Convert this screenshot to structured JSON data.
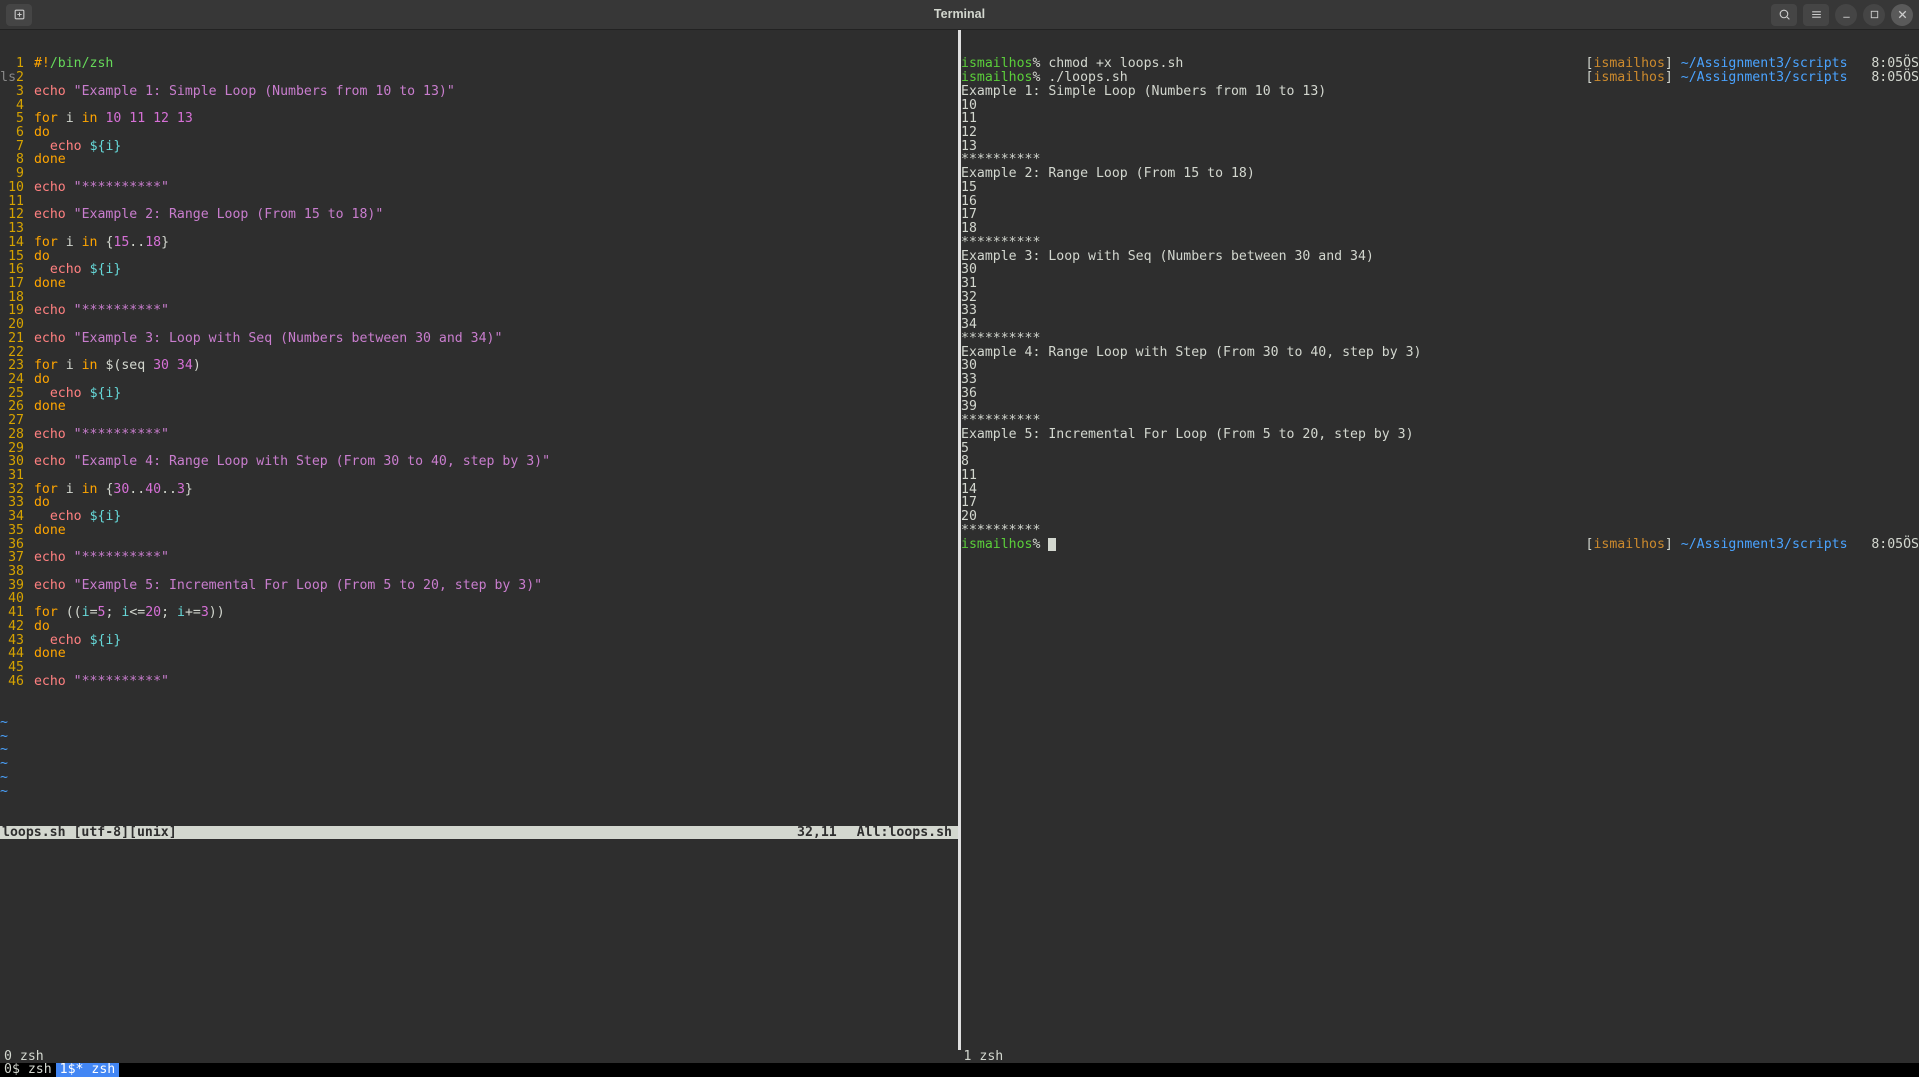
{
  "window": {
    "title": "Terminal"
  },
  "editor": {
    "lines": [
      [
        {
          "cls": "c-shebang",
          "t": "#!"
        },
        {
          "cls": "c-green",
          "t": "/bin/zsh"
        }
      ],
      [],
      [
        {
          "cls": "c-cmd",
          "t": "echo"
        },
        {
          "cls": "c-plain",
          "t": " "
        },
        {
          "cls": "c-string",
          "t": "\"Example 1: Simple Loop (Numbers from 10 to 13)\""
        }
      ],
      [],
      [
        {
          "cls": "c-kw",
          "t": "for"
        },
        {
          "cls": "c-plain",
          "t": " i "
        },
        {
          "cls": "c-kw",
          "t": "in"
        },
        {
          "cls": "c-plain",
          "t": " "
        },
        {
          "cls": "c-num",
          "t": "10 11 12 13"
        }
      ],
      [
        {
          "cls": "c-kw",
          "t": "do"
        }
      ],
      [
        {
          "cls": "c-plain",
          "t": "  "
        },
        {
          "cls": "c-cmd",
          "t": "echo"
        },
        {
          "cls": "c-plain",
          "t": " "
        },
        {
          "cls": "c-var",
          "t": "${i}"
        }
      ],
      [
        {
          "cls": "c-kw",
          "t": "done"
        }
      ],
      [],
      [
        {
          "cls": "c-cmd",
          "t": "echo"
        },
        {
          "cls": "c-plain",
          "t": " "
        },
        {
          "cls": "c-string",
          "t": "\"**********\""
        }
      ],
      [],
      [
        {
          "cls": "c-cmd",
          "t": "echo"
        },
        {
          "cls": "c-plain",
          "t": " "
        },
        {
          "cls": "c-string",
          "t": "\"Example 2: Range Loop (From 15 to 18)\""
        }
      ],
      [],
      [
        {
          "cls": "c-kw",
          "t": "for"
        },
        {
          "cls": "c-plain",
          "t": " i "
        },
        {
          "cls": "c-kw",
          "t": "in"
        },
        {
          "cls": "c-plain",
          "t": " "
        },
        {
          "cls": "c-punc",
          "t": "{"
        },
        {
          "cls": "c-num",
          "t": "15"
        },
        {
          "cls": "c-punc",
          "t": ".."
        },
        {
          "cls": "c-num",
          "t": "18"
        },
        {
          "cls": "c-punc",
          "t": "}"
        }
      ],
      [
        {
          "cls": "c-kw",
          "t": "do"
        }
      ],
      [
        {
          "cls": "c-plain",
          "t": "  "
        },
        {
          "cls": "c-cmd",
          "t": "echo"
        },
        {
          "cls": "c-plain",
          "t": " "
        },
        {
          "cls": "c-var",
          "t": "${i}"
        }
      ],
      [
        {
          "cls": "c-kw",
          "t": "done"
        }
      ],
      [],
      [
        {
          "cls": "c-cmd",
          "t": "echo"
        },
        {
          "cls": "c-plain",
          "t": " "
        },
        {
          "cls": "c-string",
          "t": "\"**********\""
        }
      ],
      [],
      [
        {
          "cls": "c-cmd",
          "t": "echo"
        },
        {
          "cls": "c-plain",
          "t": " "
        },
        {
          "cls": "c-string",
          "t": "\"Example 3: Loop with Seq (Numbers between 30 and 34)\""
        }
      ],
      [],
      [
        {
          "cls": "c-kw",
          "t": "for"
        },
        {
          "cls": "c-plain",
          "t": " i "
        },
        {
          "cls": "c-kw",
          "t": "in"
        },
        {
          "cls": "c-plain",
          "t": " "
        },
        {
          "cls": "c-punc",
          "t": "$("
        },
        {
          "cls": "c-plain",
          "t": "seq "
        },
        {
          "cls": "c-num",
          "t": "30 34"
        },
        {
          "cls": "c-punc",
          "t": ")"
        }
      ],
      [
        {
          "cls": "c-kw",
          "t": "do"
        }
      ],
      [
        {
          "cls": "c-plain",
          "t": "  "
        },
        {
          "cls": "c-cmd",
          "t": "echo"
        },
        {
          "cls": "c-plain",
          "t": " "
        },
        {
          "cls": "c-var",
          "t": "${i}"
        }
      ],
      [
        {
          "cls": "c-kw",
          "t": "done"
        }
      ],
      [],
      [
        {
          "cls": "c-cmd",
          "t": "echo"
        },
        {
          "cls": "c-plain",
          "t": " "
        },
        {
          "cls": "c-string",
          "t": "\"**********\""
        }
      ],
      [],
      [
        {
          "cls": "c-cmd",
          "t": "echo"
        },
        {
          "cls": "c-plain",
          "t": " "
        },
        {
          "cls": "c-string",
          "t": "\"Example 4: Range Loop with Step (From 30 to 40, step by 3)\""
        }
      ],
      [],
      [
        {
          "cls": "c-kw",
          "t": "for"
        },
        {
          "cls": "c-plain",
          "t": " i "
        },
        {
          "cls": "c-kw",
          "t": "in"
        },
        {
          "cls": "c-plain",
          "t": " "
        },
        {
          "cls": "c-punc",
          "t": "{"
        },
        {
          "cls": "c-num",
          "t": "30"
        },
        {
          "cls": "c-punc",
          "t": ".."
        },
        {
          "cls": "c-num",
          "t": "40"
        },
        {
          "cls": "c-punc",
          "t": ".."
        },
        {
          "cls": "c-num",
          "t": "3"
        },
        {
          "cls": "c-punc",
          "t": "}"
        }
      ],
      [
        {
          "cls": "c-kw",
          "t": "do"
        }
      ],
      [
        {
          "cls": "c-plain",
          "t": "  "
        },
        {
          "cls": "c-cmd",
          "t": "echo"
        },
        {
          "cls": "c-plain",
          "t": " "
        },
        {
          "cls": "c-var",
          "t": "${i}"
        }
      ],
      [
        {
          "cls": "c-kw",
          "t": "done"
        }
      ],
      [],
      [
        {
          "cls": "c-cmd",
          "t": "echo"
        },
        {
          "cls": "c-plain",
          "t": " "
        },
        {
          "cls": "c-string",
          "t": "\"**********\""
        }
      ],
      [],
      [
        {
          "cls": "c-cmd",
          "t": "echo"
        },
        {
          "cls": "c-plain",
          "t": " "
        },
        {
          "cls": "c-string",
          "t": "\"Example 5: Incremental For Loop (From 5 to 20, step by 3)\""
        }
      ],
      [],
      [
        {
          "cls": "c-kw",
          "t": "for"
        },
        {
          "cls": "c-plain",
          "t": " "
        },
        {
          "cls": "c-punc",
          "t": "(("
        },
        {
          "cls": "c-var",
          "t": "i"
        },
        {
          "cls": "c-punc",
          "t": "="
        },
        {
          "cls": "c-num",
          "t": "5"
        },
        {
          "cls": "c-punc",
          "t": "; "
        },
        {
          "cls": "c-var",
          "t": "i"
        },
        {
          "cls": "c-punc",
          "t": "<="
        },
        {
          "cls": "c-num",
          "t": "20"
        },
        {
          "cls": "c-punc",
          "t": "; "
        },
        {
          "cls": "c-var",
          "t": "i"
        },
        {
          "cls": "c-punc",
          "t": "+="
        },
        {
          "cls": "c-num",
          "t": "3"
        },
        {
          "cls": "c-punc",
          "t": "))"
        }
      ],
      [
        {
          "cls": "c-kw",
          "t": "do"
        }
      ],
      [
        {
          "cls": "c-plain",
          "t": "  "
        },
        {
          "cls": "c-cmd",
          "t": "echo"
        },
        {
          "cls": "c-plain",
          "t": " "
        },
        {
          "cls": "c-var",
          "t": "${i}"
        }
      ],
      [
        {
          "cls": "c-kw",
          "t": "done"
        }
      ],
      [],
      [
        {
          "cls": "c-cmd",
          "t": "echo"
        },
        {
          "cls": "c-plain",
          "t": " "
        },
        {
          "cls": "c-string",
          "t": "\"**********\""
        }
      ]
    ],
    "tilde_count": 6,
    "status": {
      "left": "loops.sh [utf-8][unix]",
      "mid": "32,11",
      "right": "All:loops.sh"
    }
  },
  "shell": {
    "prompts": [
      {
        "user": "ismailhos",
        "cmd": "chmod +x loops.sh",
        "ruser": "ismailhos",
        "rpath": "~/Assignment3/scripts",
        "rtime": "8:05ÖS"
      },
      {
        "user": "ismailhos",
        "cmd": "./loops.sh",
        "ruser": "",
        "rpath": "",
        "rtime": ""
      }
    ],
    "output": [
      "Example 1: Simple Loop (Numbers from 10 to 13)",
      "10",
      "11",
      "12",
      "13",
      "**********",
      "Example 2: Range Loop (From 15 to 18)",
      "15",
      "16",
      "17",
      "18",
      "**********",
      "Example 3: Loop with Seq (Numbers between 30 and 34)",
      "30",
      "31",
      "32",
      "33",
      "34",
      "**********",
      "Example 4: Range Loop with Step (From 30 to 40, step by 3)",
      "30",
      "33",
      "36",
      "39",
      "**********",
      "Example 5: Incremental For Loop (From 5 to 20, step by 3)",
      "5",
      "8",
      "11",
      "14",
      "17",
      "20",
      "**********"
    ],
    "prompt_end": {
      "user": "ismailhos",
      "ruser": "ismailhos",
      "rpath": "~/Assignment3/scripts",
      "rtime": "8:05ÖS"
    },
    "right_prompt1": {
      "ruser": "ismailhos",
      "rpath": "~/Assignment3/scripts",
      "rtime": "8:05ÖS"
    }
  },
  "pane_titles": {
    "left": "0 zsh",
    "right": "1 zsh"
  },
  "tmux": {
    "tab0": "0$ zsh",
    "tab1": "1$* zsh"
  }
}
